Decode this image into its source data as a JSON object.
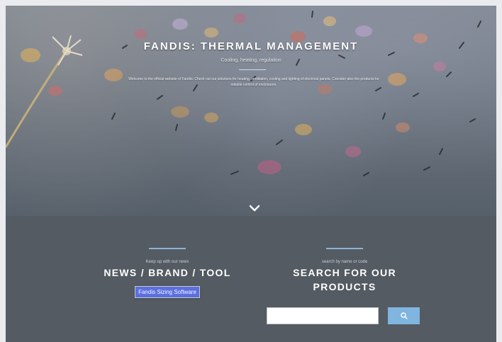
{
  "hero": {
    "title": "FANDIS: THERMAL MANAGEMENT",
    "subtitle": "Cooling, heating, regulation",
    "text": "Welcome to the official website of Fandis. Check out our solutions for heating, ventilation, cooling and lighting of electrical panels. Consider also the products for reliable control of enclosures."
  },
  "news": {
    "kicker": "Keep up with our news",
    "title": "NEWS / BRAND / TOOL",
    "badge": "Fandis Sizing Software"
  },
  "search": {
    "kicker": "search by name or code",
    "title": "SEARCH FOR OUR PRODUCTS",
    "input_value": "",
    "input_placeholder": "",
    "button_icon": "search-icon"
  },
  "icons": {
    "scroll_down": "chevron-down-icon"
  },
  "colors": {
    "accent_line": "#8fb2d3",
    "section_bg": "#545b62",
    "badge_bg": "#5b6fe0",
    "button_bg": "#7fb5df"
  }
}
